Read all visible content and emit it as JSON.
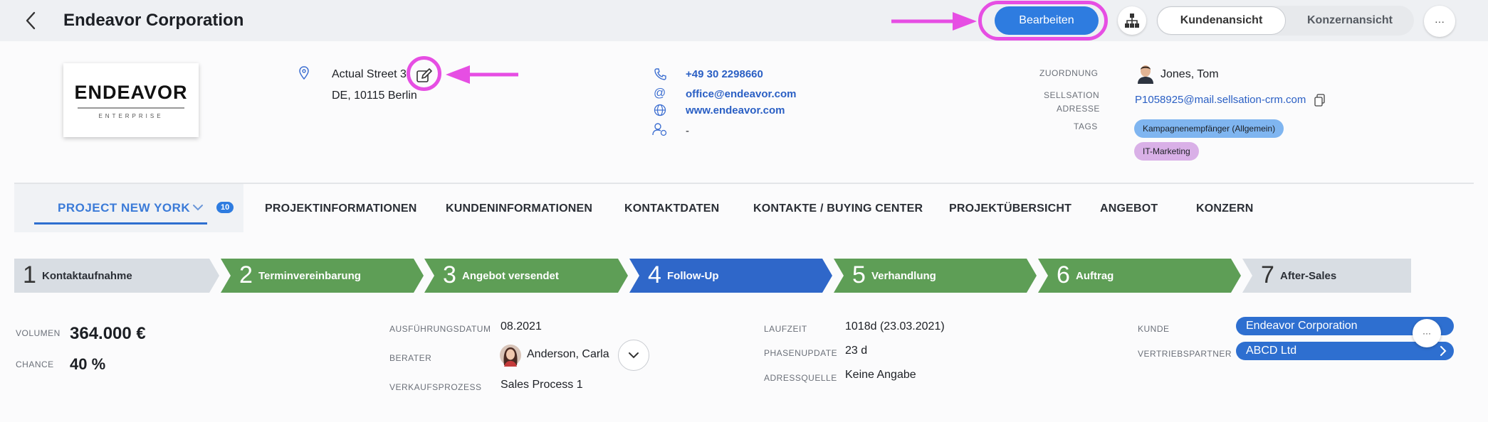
{
  "header": {
    "title": "Endeavor Corporation",
    "edit_label": "Bearbeiten",
    "view_customer_label": "Kundenansicht",
    "view_group_label": "Konzernansicht",
    "more_label": "···"
  },
  "company": {
    "logo_text": "ENDEAVOR",
    "logo_subtext": "ENTERPRISE",
    "address_line1": "Actual Street 3",
    "address_line2": "DE, 10115 Berlin",
    "phone": "+49 30 2298660",
    "email": "office@endeavor.com",
    "website": "www.endeavor.com",
    "contact_person": "-",
    "zuordnung_label": "ZUORDNUNG",
    "zuordnung_value": "Jones, Tom",
    "sellsation_label_1": "SELLSATION",
    "sellsation_label_2": "ADRESSE",
    "sellsation_value": "P1058925@mail.sellsation-crm.com",
    "tags_label": "TAGS",
    "tags": [
      "Kampagnenempfänger (Allgemein)",
      "IT-Marketing"
    ]
  },
  "tabs": {
    "project_name": "PROJECT NEW YORK",
    "project_badge": "10",
    "items": [
      "PROJEKTINFORMATIONEN",
      "KUNDENINFORMATIONEN",
      "KONTAKTDATEN",
      "KONTAKTE / BUYING CENTER",
      "PROJEKTÜBERSICHT",
      "ANGEBOT",
      "KONZERN"
    ]
  },
  "phases": [
    {
      "num": "1",
      "label": "Kontaktaufnahme",
      "status": "inactive"
    },
    {
      "num": "2",
      "label": "Terminvereinbarung",
      "status": "done"
    },
    {
      "num": "3",
      "label": "Angebot versendet",
      "status": "done"
    },
    {
      "num": "4",
      "label": "Follow-Up",
      "status": "current"
    },
    {
      "num": "5",
      "label": "Verhandlung",
      "status": "done"
    },
    {
      "num": "6",
      "label": "Auftrag",
      "status": "done"
    },
    {
      "num": "7",
      "label": "After-Sales",
      "status": "inactive"
    }
  ],
  "colors": {
    "phase_done": "#5e9e56",
    "phase_current": "#2f67c9",
    "phase_inactive": "#d8dde3",
    "accent": "#2e7ce0",
    "highlight": "#e64ee3"
  },
  "details": {
    "volume_label": "VOLUMEN",
    "volume_value": "364.000 €",
    "chance_label": "CHANCE",
    "chance_value": "40 %",
    "execution_date_label": "AUSFÜHRUNGSDATUM",
    "execution_date_value": "08.2021",
    "advisor_label": "BERATER",
    "advisor_value": "Anderson, Carla",
    "sales_process_label": "VERKAUFSPROZESS",
    "sales_process_value": "Sales Process 1",
    "runtime_label": "LAUFZEIT",
    "runtime_value": "1018d (23.03.2021)",
    "phase_update_label": "PHASENUPDATE",
    "phase_update_value": "23 d",
    "address_source_label": "ADRESSQUELLE",
    "address_source_value": "Keine Angabe",
    "customer_label": "KUNDE",
    "customer_value": "Endeavor Corporation",
    "partner_label": "VERTRIEBSPARTNER",
    "partner_value": "ABCD Ltd"
  }
}
